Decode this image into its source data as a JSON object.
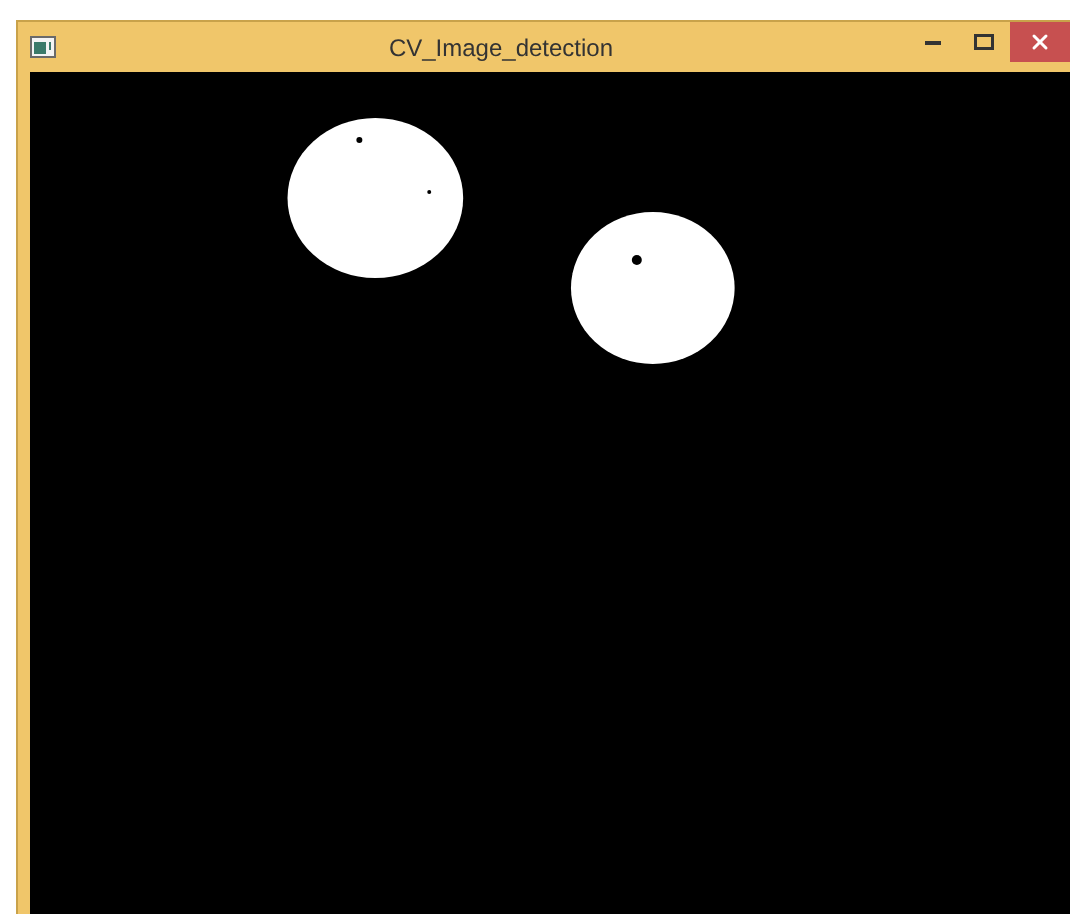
{
  "window": {
    "title": "CV_Image_detection"
  }
}
